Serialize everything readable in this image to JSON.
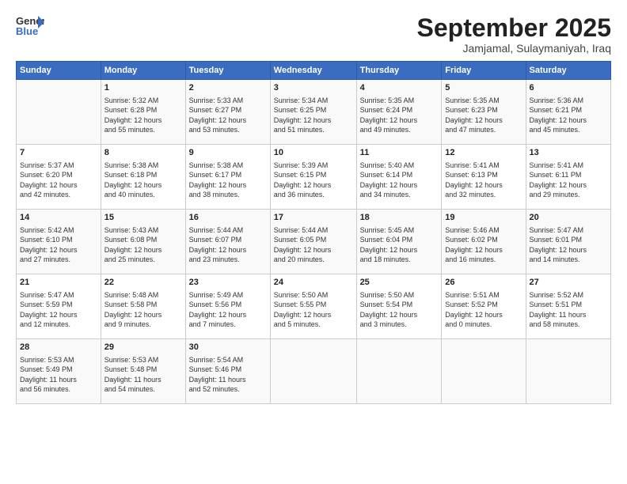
{
  "header": {
    "logo_line1": "General",
    "logo_line2": "Blue",
    "month": "September 2025",
    "location": "Jamjamal, Sulaymaniyah, Iraq"
  },
  "weekdays": [
    "Sunday",
    "Monday",
    "Tuesday",
    "Wednesday",
    "Thursday",
    "Friday",
    "Saturday"
  ],
  "weeks": [
    [
      {
        "day": "",
        "text": ""
      },
      {
        "day": "1",
        "text": "Sunrise: 5:32 AM\nSunset: 6:28 PM\nDaylight: 12 hours\nand 55 minutes."
      },
      {
        "day": "2",
        "text": "Sunrise: 5:33 AM\nSunset: 6:27 PM\nDaylight: 12 hours\nand 53 minutes."
      },
      {
        "day": "3",
        "text": "Sunrise: 5:34 AM\nSunset: 6:25 PM\nDaylight: 12 hours\nand 51 minutes."
      },
      {
        "day": "4",
        "text": "Sunrise: 5:35 AM\nSunset: 6:24 PM\nDaylight: 12 hours\nand 49 minutes."
      },
      {
        "day": "5",
        "text": "Sunrise: 5:35 AM\nSunset: 6:23 PM\nDaylight: 12 hours\nand 47 minutes."
      },
      {
        "day": "6",
        "text": "Sunrise: 5:36 AM\nSunset: 6:21 PM\nDaylight: 12 hours\nand 45 minutes."
      }
    ],
    [
      {
        "day": "7",
        "text": "Sunrise: 5:37 AM\nSunset: 6:20 PM\nDaylight: 12 hours\nand 42 minutes."
      },
      {
        "day": "8",
        "text": "Sunrise: 5:38 AM\nSunset: 6:18 PM\nDaylight: 12 hours\nand 40 minutes."
      },
      {
        "day": "9",
        "text": "Sunrise: 5:38 AM\nSunset: 6:17 PM\nDaylight: 12 hours\nand 38 minutes."
      },
      {
        "day": "10",
        "text": "Sunrise: 5:39 AM\nSunset: 6:15 PM\nDaylight: 12 hours\nand 36 minutes."
      },
      {
        "day": "11",
        "text": "Sunrise: 5:40 AM\nSunset: 6:14 PM\nDaylight: 12 hours\nand 34 minutes."
      },
      {
        "day": "12",
        "text": "Sunrise: 5:41 AM\nSunset: 6:13 PM\nDaylight: 12 hours\nand 32 minutes."
      },
      {
        "day": "13",
        "text": "Sunrise: 5:41 AM\nSunset: 6:11 PM\nDaylight: 12 hours\nand 29 minutes."
      }
    ],
    [
      {
        "day": "14",
        "text": "Sunrise: 5:42 AM\nSunset: 6:10 PM\nDaylight: 12 hours\nand 27 minutes."
      },
      {
        "day": "15",
        "text": "Sunrise: 5:43 AM\nSunset: 6:08 PM\nDaylight: 12 hours\nand 25 minutes."
      },
      {
        "day": "16",
        "text": "Sunrise: 5:44 AM\nSunset: 6:07 PM\nDaylight: 12 hours\nand 23 minutes."
      },
      {
        "day": "17",
        "text": "Sunrise: 5:44 AM\nSunset: 6:05 PM\nDaylight: 12 hours\nand 20 minutes."
      },
      {
        "day": "18",
        "text": "Sunrise: 5:45 AM\nSunset: 6:04 PM\nDaylight: 12 hours\nand 18 minutes."
      },
      {
        "day": "19",
        "text": "Sunrise: 5:46 AM\nSunset: 6:02 PM\nDaylight: 12 hours\nand 16 minutes."
      },
      {
        "day": "20",
        "text": "Sunrise: 5:47 AM\nSunset: 6:01 PM\nDaylight: 12 hours\nand 14 minutes."
      }
    ],
    [
      {
        "day": "21",
        "text": "Sunrise: 5:47 AM\nSunset: 5:59 PM\nDaylight: 12 hours\nand 12 minutes."
      },
      {
        "day": "22",
        "text": "Sunrise: 5:48 AM\nSunset: 5:58 PM\nDaylight: 12 hours\nand 9 minutes."
      },
      {
        "day": "23",
        "text": "Sunrise: 5:49 AM\nSunset: 5:56 PM\nDaylight: 12 hours\nand 7 minutes."
      },
      {
        "day": "24",
        "text": "Sunrise: 5:50 AM\nSunset: 5:55 PM\nDaylight: 12 hours\nand 5 minutes."
      },
      {
        "day": "25",
        "text": "Sunrise: 5:50 AM\nSunset: 5:54 PM\nDaylight: 12 hours\nand 3 minutes."
      },
      {
        "day": "26",
        "text": "Sunrise: 5:51 AM\nSunset: 5:52 PM\nDaylight: 12 hours\nand 0 minutes."
      },
      {
        "day": "27",
        "text": "Sunrise: 5:52 AM\nSunset: 5:51 PM\nDaylight: 11 hours\nand 58 minutes."
      }
    ],
    [
      {
        "day": "28",
        "text": "Sunrise: 5:53 AM\nSunset: 5:49 PM\nDaylight: 11 hours\nand 56 minutes."
      },
      {
        "day": "29",
        "text": "Sunrise: 5:53 AM\nSunset: 5:48 PM\nDaylight: 11 hours\nand 54 minutes."
      },
      {
        "day": "30",
        "text": "Sunrise: 5:54 AM\nSunset: 5:46 PM\nDaylight: 11 hours\nand 52 minutes."
      },
      {
        "day": "",
        "text": ""
      },
      {
        "day": "",
        "text": ""
      },
      {
        "day": "",
        "text": ""
      },
      {
        "day": "",
        "text": ""
      }
    ]
  ]
}
